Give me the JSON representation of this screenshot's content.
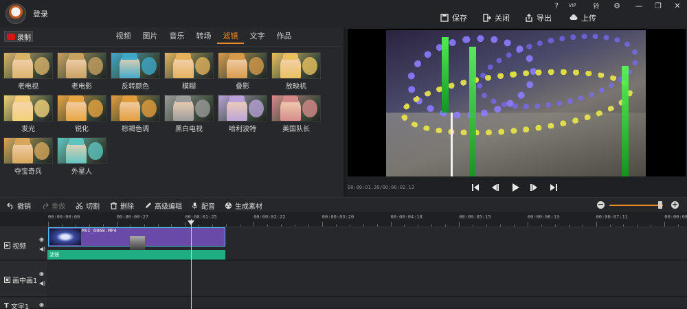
{
  "titlebar": {
    "login": "登录",
    "window_controls": [
      "?",
      "VIP",
      "铃",
      "⚙",
      "—",
      "❐",
      "✕"
    ],
    "actions": {
      "save": "保存",
      "close": "关闭",
      "export": "导出",
      "upload": "上传"
    }
  },
  "left_panel": {
    "record_label": "录制",
    "tabs": [
      "视频",
      "图片",
      "音乐",
      "转场",
      "滤镜",
      "文字",
      "作品"
    ],
    "active_tab": "滤镜",
    "filters": [
      {
        "label": "老电视",
        "tint": "#d9b36a"
      },
      {
        "label": "老电影",
        "tint": "#c8a060"
      },
      {
        "label": "反转颜色",
        "tint": "#3fa8c8"
      },
      {
        "label": "模糊",
        "tint": "#e4b25e"
      },
      {
        "label": "叠影",
        "tint": "#d69a4a"
      },
      {
        "label": "放映机",
        "tint": "#e8c060"
      },
      {
        "label": "发光",
        "tint": "#f3d27a"
      },
      {
        "label": "锐化",
        "tint": "#e8a440"
      },
      {
        "label": "棕褐色调",
        "tint": "#e39c3a"
      },
      {
        "label": "黑白电视",
        "tint": "#9a9a9a"
      },
      {
        "label": "哈利波特",
        "tint": "#b9a3d8"
      },
      {
        "label": "美国队长",
        "tint": "#d58a8a"
      },
      {
        "label": "夺宝奇兵",
        "tint": "#d7a65a"
      },
      {
        "label": "外星人",
        "tint": "#5ec4c0"
      }
    ]
  },
  "preview": {
    "timecode": "00:00:01.28/00:00:02.13"
  },
  "toolbar": {
    "undo": "撤销",
    "redo": "重做",
    "cut": "切割",
    "delete": "删除",
    "advanced_edit": "高级编辑",
    "dub": "配音",
    "generate": "生成素材",
    "zoom_level": 0.95
  },
  "timeline": {
    "ticks": [
      "00:00:00:00",
      "00:00:00:27",
      "00:00:01:25",
      "00:00:02:22",
      "00:00:03:20",
      "00:00:04:18",
      "00:00:05:15",
      "00:00:06:13",
      "00:00:07:11",
      "00:00:08:0"
    ],
    "tracks": {
      "video": "视频",
      "pip": "画中画1",
      "text": "文字1"
    },
    "clip_name": "MVI_6060.MP4",
    "filter_bar": "滤镜"
  },
  "colors": {
    "accent": "#f08a24",
    "clip": "#6a4aa8",
    "filter_bar": "#1fae82"
  }
}
